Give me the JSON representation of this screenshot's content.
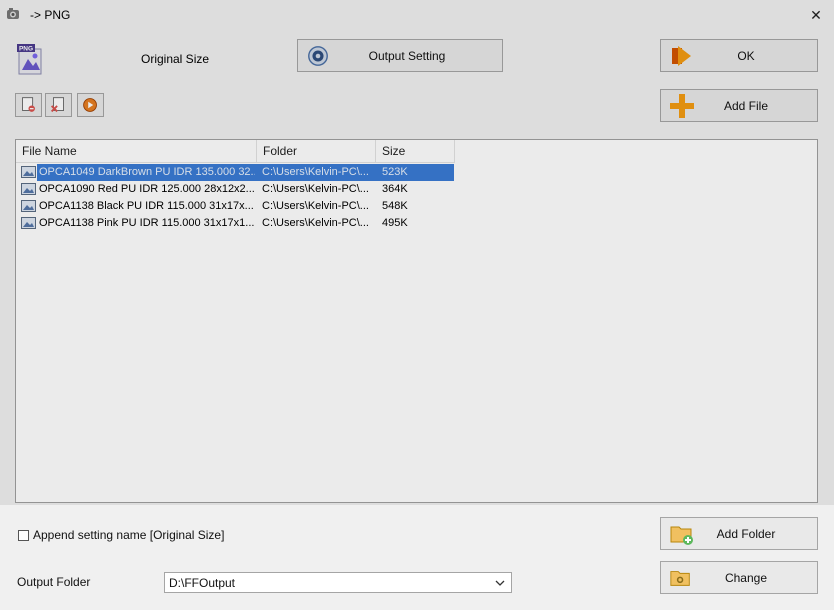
{
  "window": {
    "title": "-> PNG",
    "close_glyph": "✕"
  },
  "header": {
    "format_badge": "PNG",
    "size_label": "Original Size",
    "output_setting_label": "Output Setting",
    "ok_label": "OK",
    "add_file_label": "Add File"
  },
  "toolbar": {
    "icons": [
      "remove-file-icon",
      "clear-list-icon",
      "play-icon"
    ]
  },
  "list": {
    "columns": [
      "File Name",
      "Folder",
      "Size"
    ],
    "rows": [
      {
        "name": "OPCA1049 DarkBrown PU IDR 135.000 32...",
        "folder": "C:\\Users\\Kelvin-PC\\...",
        "size": "523K",
        "selected": true
      },
      {
        "name": "OPCA1090 Red PU IDR 125.000 28x12x2...",
        "folder": "C:\\Users\\Kelvin-PC\\...",
        "size": "364K",
        "selected": false
      },
      {
        "name": "OPCA1138 Black PU IDR 115.000 31x17x...",
        "folder": "C:\\Users\\Kelvin-PC\\...",
        "size": "548K",
        "selected": false
      },
      {
        "name": "OPCA1138 Pink PU IDR 115.000 31x17x1...",
        "folder": "C:\\Users\\Kelvin-PC\\...",
        "size": "495K",
        "selected": false
      }
    ]
  },
  "footer": {
    "append_label": "Append setting name [Original Size]",
    "append_checked": false,
    "add_folder_label": "Add Folder",
    "output_folder_label": "Output Folder",
    "output_folder_value": "D:\\FFOutput",
    "change_label": "Change"
  },
  "colors": {
    "selection": "#3a7bd5",
    "accent_orange": "#f39c12"
  }
}
